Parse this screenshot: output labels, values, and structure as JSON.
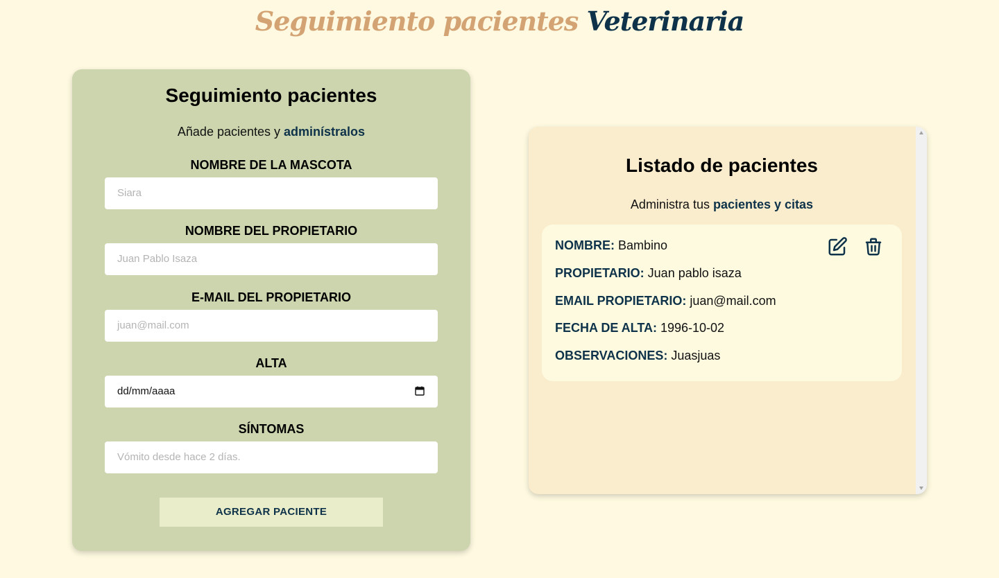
{
  "app_title": {
    "part1": "Seguimiento pacientes",
    "part2": "Veterinaria"
  },
  "form": {
    "title": "Seguimiento pacientes",
    "subtitle_text": "Añade pacientes y",
    "subtitle_highlight": "adminístralos",
    "fields": [
      {
        "label": "NOMBRE DE LA MASCOTA",
        "placeholder": "Siara"
      },
      {
        "label": "NOMBRE DEL PROPIETARIO",
        "placeholder": "Juan Pablo Isaza"
      },
      {
        "label": "E-MAIL DEL PROPIETARIO",
        "placeholder": "juan@mail.com"
      },
      {
        "label": "ALTA",
        "placeholder": "dd/mm/aaaa"
      },
      {
        "label": "SÍNTOMAS",
        "placeholder": "Vómito desde hace 2 días."
      }
    ],
    "submit_label": "AGREGAR PACIENTE"
  },
  "list": {
    "title": "Listado de pacientes",
    "subtitle_text": "Administra tus",
    "subtitle_highlight": "pacientes y citas",
    "patients": [
      {
        "rows": [
          {
            "key": "NOMBRE:",
            "value": "Bambino"
          },
          {
            "key": "PROPIETARIO:",
            "value": "Juan pablo isaza"
          },
          {
            "key": "EMAIL PROPIETARIO:",
            "value": "juan@mail.com"
          },
          {
            "key": "FECHA DE ALTA:",
            "value": "1996-10-02"
          },
          {
            "key": "OBSERVACIONES:",
            "value": "Juasjuas"
          }
        ],
        "actions": {
          "edit_icon": "edit-icon",
          "delete_icon": "trash-icon"
        }
      }
    ]
  },
  "colors": {
    "background": "#fef9e0",
    "title_tan": "#d4a373",
    "navy": "#0e3249",
    "form_card": "#ccd5ae",
    "button": "#e9edc9",
    "list_card": "#faedcd",
    "patient_card": "#fefae0"
  }
}
